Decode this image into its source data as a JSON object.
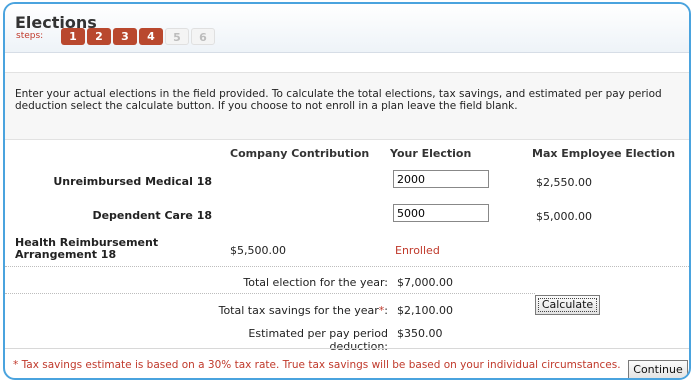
{
  "page": {
    "title": "Elections",
    "steps_label": "steps:",
    "steps": [
      {
        "label": "1",
        "state": "active"
      },
      {
        "label": "2",
        "state": "active"
      },
      {
        "label": "3",
        "state": "active"
      },
      {
        "label": "4",
        "state": "active"
      },
      {
        "label": "5",
        "state": "inactive"
      },
      {
        "label": "6",
        "state": "inactive"
      }
    ],
    "instructions": "Enter your actual elections in the field provided. To calculate the total elections, tax savings, and estimated per pay period deduction select the calculate button. If you choose to not enroll in a plan leave the field blank."
  },
  "table": {
    "headers": {
      "company": "Company Contribution",
      "election": "Your Election",
      "max": "Max Employee Election"
    },
    "rows": [
      {
        "plan": "Unreimbursed Medical 18",
        "company": "",
        "election": "2000",
        "max": "$2,550.00"
      },
      {
        "plan": "Dependent Care 18",
        "company": "",
        "election": "5000",
        "max": "$5,000.00"
      },
      {
        "plan": "Health Reimbursement Arrangement 18",
        "company": "$5,500.00",
        "election_text": "Enrolled",
        "max": ""
      }
    ]
  },
  "totals": {
    "total_label": "Total election for the year:",
    "total_value": "$7,000.00",
    "tax_label": "Total tax savings for the year",
    "tax_asterisk": "*",
    "tax_colon": ":",
    "tax_value": "$2,100.00",
    "perpay_label": "Estimated per pay period deduction:",
    "perpay_value": "$350.00"
  },
  "buttons": {
    "calculate": "Calculate",
    "continue": "Continue"
  },
  "footnote": "* Tax savings estimate is based on a 30% tax rate. True tax savings will be based on your individual circumstances.",
  "colors": {
    "accent_border": "#4aa3de",
    "step_active": "#b9482e",
    "alert_red": "#c0392b"
  }
}
